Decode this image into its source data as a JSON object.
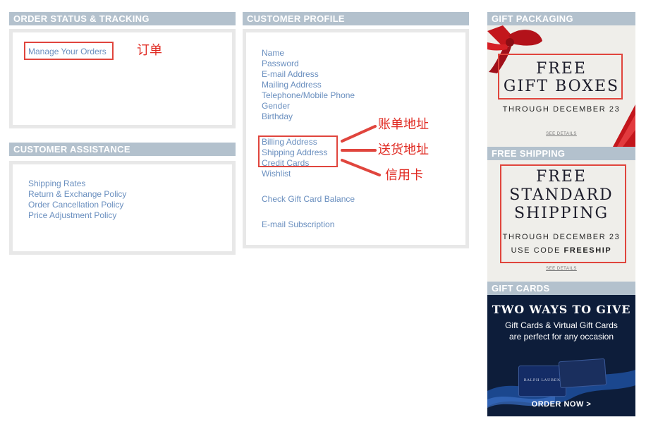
{
  "order_section": {
    "header": "ORDER STATUS & TRACKING",
    "link": "Manage Your Orders",
    "annotation": "订单"
  },
  "assistance_section": {
    "header": "CUSTOMER ASSISTANCE",
    "links": [
      "Shipping Rates",
      "Return & Exchange Policy",
      "Order Cancellation Policy",
      "Price Adjustment Policy"
    ]
  },
  "profile_section": {
    "header": "CUSTOMER PROFILE",
    "links_group1": [
      "Name",
      "Password",
      "E-mail Address",
      "Mailing Address",
      "Telephone/Mobile Phone",
      "Gender",
      "Birthday"
    ],
    "links_group2": [
      "Billing Address",
      "Shipping Address",
      "Credit Cards",
      "Wishlist"
    ],
    "gift_card_link": "Check Gift Card Balance",
    "subscription_link": "E-mail Subscription",
    "annotations": [
      "账单地址",
      "送货地址",
      "信用卡"
    ]
  },
  "gift_packaging": {
    "header": "GIFT PACKAGING",
    "line1": "FREE",
    "line2": "GIFT BOXES",
    "through": "THROUGH DECEMBER 23",
    "see_details": "SEE DETAILS"
  },
  "free_shipping": {
    "header": "FREE SHIPPING",
    "line1": "FREE",
    "line2": "STANDARD",
    "line3": "SHIPPING",
    "through": "THROUGH DECEMBER 23",
    "code_prefix": "USE CODE ",
    "code": "FREESHIP",
    "see_details": "SEE DETAILS"
  },
  "gift_cards": {
    "header": "GIFT CARDS",
    "headline": "TWO WAYS TO GIVE",
    "sub1": "Gift Cards & Virtual Gift Cards",
    "sub2": "are perfect for any occasion",
    "card_brand": "RALPH LAUREN",
    "cta": "ORDER NOW >"
  },
  "colors": {
    "header_bg": "#b3c1cd",
    "link": "#6a8fbf",
    "annotation_red": "#e0453d",
    "gift_card_bg": "#0d1d3a"
  }
}
